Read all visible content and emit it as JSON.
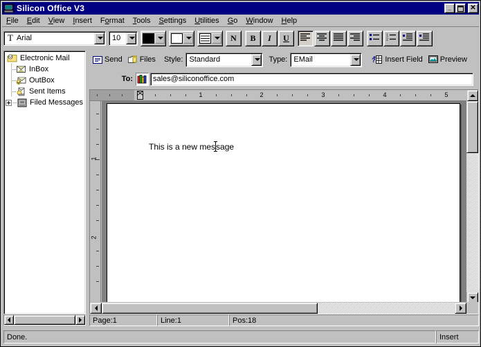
{
  "window": {
    "title": "Silicon Office V3",
    "icon": "computer-icon",
    "minimize_label": "_",
    "maximize_label": "□",
    "close_label": "✕"
  },
  "menu": [
    {
      "label": "File",
      "accel": "F"
    },
    {
      "label": "Edit",
      "accel": "E"
    },
    {
      "label": "View",
      "accel": "V"
    },
    {
      "label": "Insert",
      "accel": "I"
    },
    {
      "label": "Format",
      "accel": "o"
    },
    {
      "label": "Tools",
      "accel": "T"
    },
    {
      "label": "Settings",
      "accel": "S"
    },
    {
      "label": "Utilities",
      "accel": "U"
    },
    {
      "label": "Go",
      "accel": "G"
    },
    {
      "label": "Window",
      "accel": "W"
    },
    {
      "label": "Help",
      "accel": "H"
    }
  ],
  "format_toolbar": {
    "font_name": "Arial",
    "font_name_icon": "font-icon",
    "font_size": "10",
    "fill_color": "#000000",
    "line_color": "#ffffff",
    "border_icon": "borders-icon",
    "buttons": [
      {
        "name": "numeric-format-button",
        "label": "N",
        "pressed": false
      },
      {
        "name": "bold-button",
        "label": "B",
        "pressed": false
      },
      {
        "name": "italic-button",
        "label": "I",
        "pressed": false
      },
      {
        "name": "underline-button",
        "label": "U",
        "pressed": false
      },
      {
        "name": "align-left-button",
        "label": "align-left-icon",
        "pressed": true
      },
      {
        "name": "align-center-button",
        "label": "align-center-icon",
        "pressed": false
      },
      {
        "name": "align-justify-button",
        "label": "align-justify-icon",
        "pressed": false
      },
      {
        "name": "align-right-button",
        "label": "align-right-icon",
        "pressed": false
      },
      {
        "name": "bullet-list-button",
        "label": "bullet-list-icon",
        "pressed": false
      },
      {
        "name": "numbered-list-button",
        "label": "numbered-list-icon",
        "pressed": false
      },
      {
        "name": "decrease-indent-button",
        "label": "decrease-indent-icon",
        "pressed": false
      },
      {
        "name": "increase-indent-button",
        "label": "increase-indent-icon",
        "pressed": false
      }
    ]
  },
  "mail_toolbar": {
    "send_label": "Send",
    "send_icon": "envelope-icon",
    "files_label": "Files",
    "files_icon": "attach-folder-icon",
    "style_label": "Style:",
    "style_value": "Standard",
    "type_label": "Type:",
    "type_value": "EMail",
    "insert_field_label": "Insert Field",
    "insert_field_icon": "insert-field-icon",
    "preview_label": "Preview",
    "preview_icon": "monitor-icon"
  },
  "to_row": {
    "label": "To:",
    "address_book_icon": "address-book-icon",
    "value": "sales@siliconoffice.com",
    "placeholder": ""
  },
  "sidebar": {
    "root": {
      "label": "Electronic Mail",
      "icon": "mail-folder-icon"
    },
    "items": [
      {
        "label": "InBox",
        "icon": "inbox-icon",
        "expandable": false
      },
      {
        "label": "OutBox",
        "icon": "outbox-icon",
        "expandable": false
      },
      {
        "label": "Sent Items",
        "icon": "sent-items-icon",
        "expandable": false
      },
      {
        "label": "Filed Messages",
        "icon": "filed-messages-icon",
        "expandable": true
      }
    ]
  },
  "ruler": {
    "h_numbers": [
      "1",
      "2",
      "3",
      "4",
      "5"
    ],
    "v_numbers": [
      "1",
      "2"
    ],
    "indent_marker": "indent-marker-icon"
  },
  "document": {
    "text_before_caret": "This is a new mes",
    "text_after_caret": "sage"
  },
  "doc_status": {
    "page": "Page:1",
    "line": "Line:1",
    "pos": "Pos:18"
  },
  "app_status": {
    "message": "Done.",
    "mode": "Insert"
  }
}
